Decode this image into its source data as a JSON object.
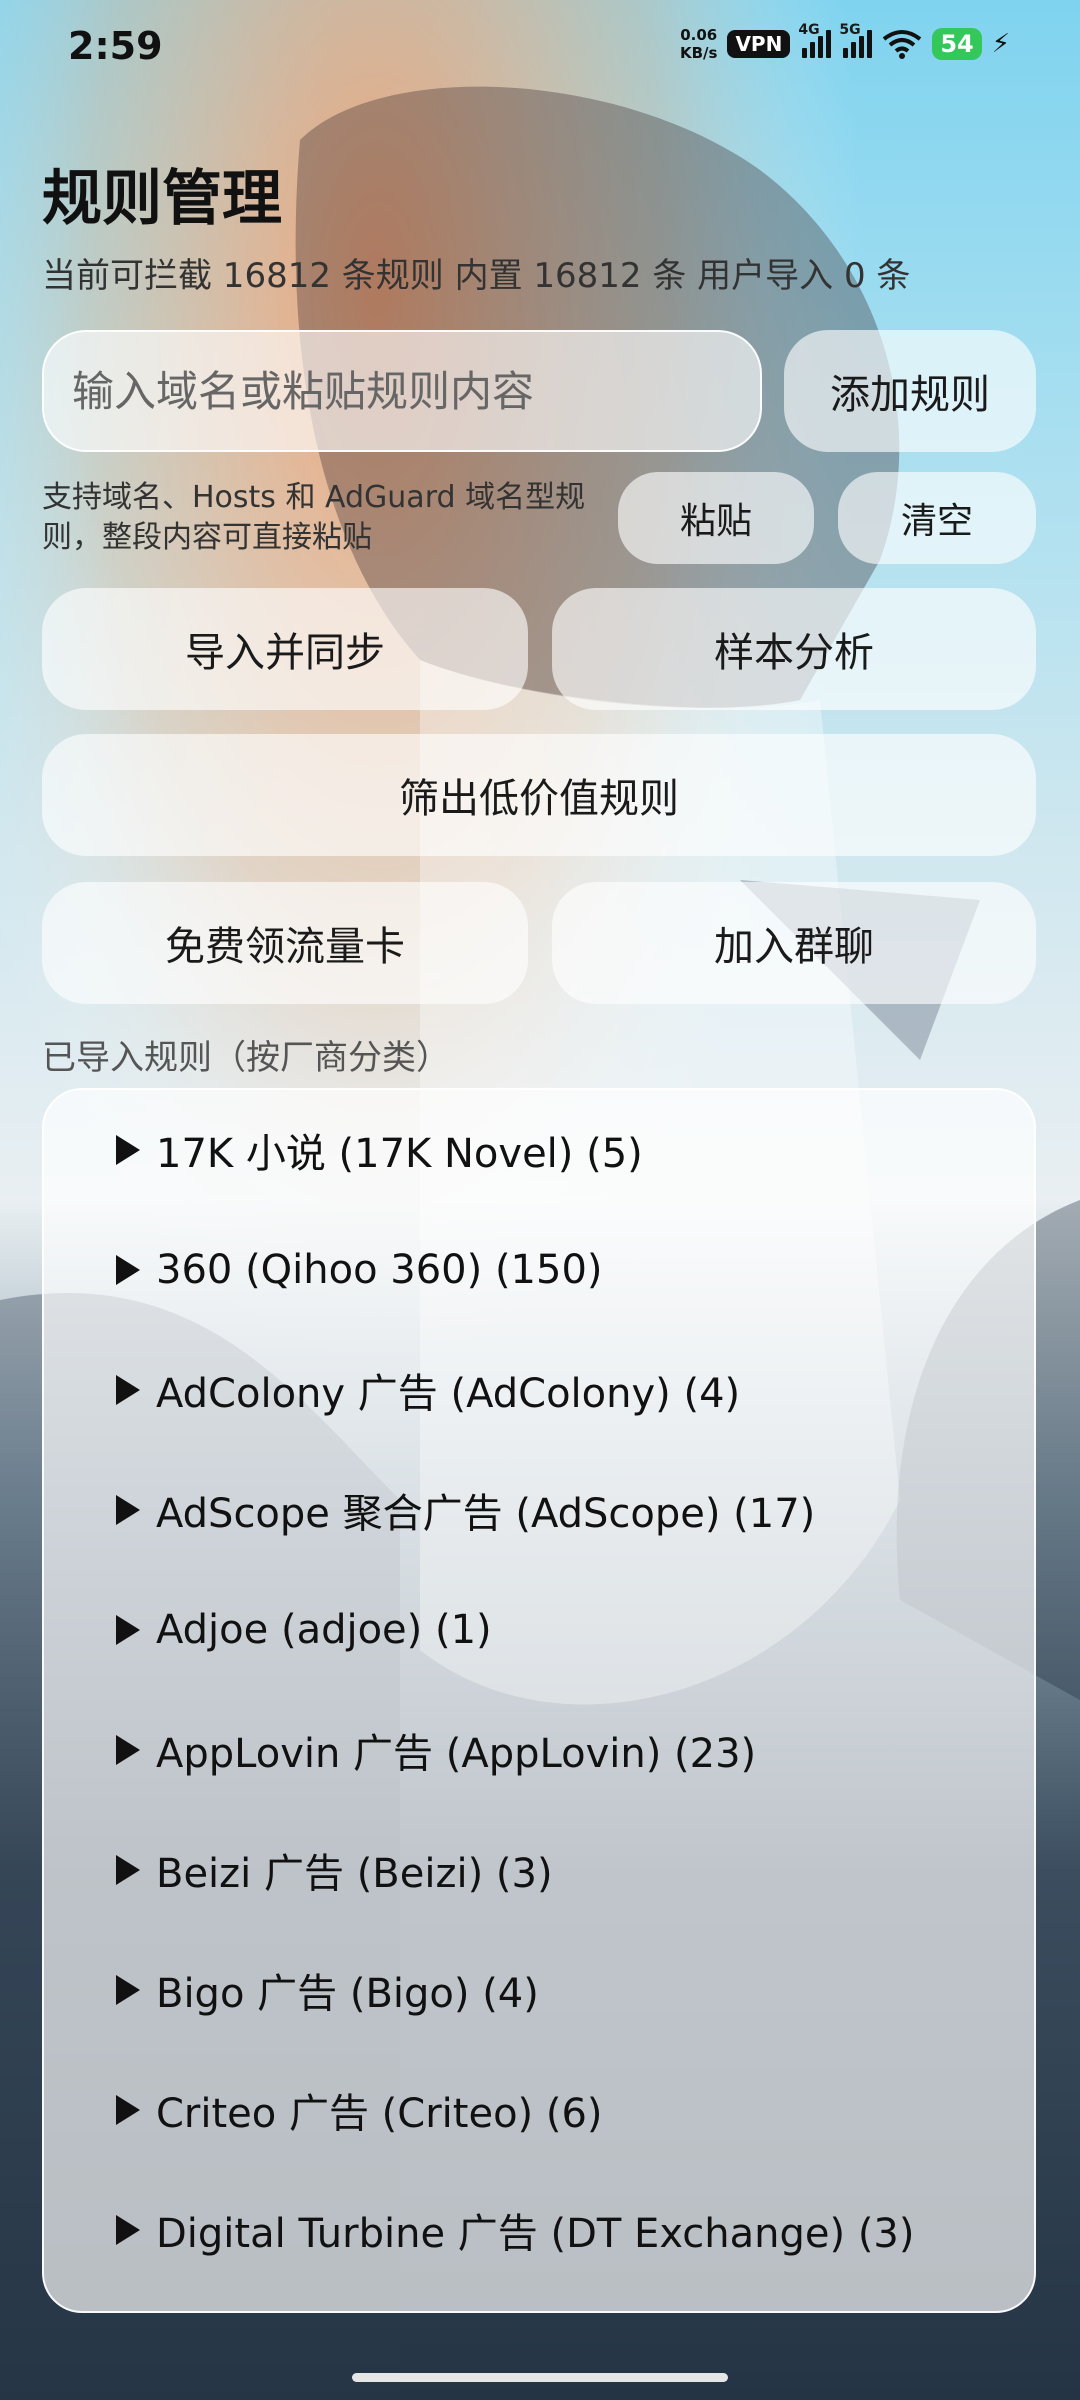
{
  "status_bar": {
    "time": "2:59",
    "net_speed_value": "0.06",
    "net_speed_unit": "KB/s",
    "vpn": "VPN",
    "signal_1_label": "4G",
    "signal_2_label": "5G",
    "battery": "54"
  },
  "header": {
    "title": "规则管理",
    "subtitle": "当前可拦截 16812 条规则  内置 16812 条  用户导入 0 条"
  },
  "rule_input": {
    "placeholder": "输入域名或粘贴规则内容",
    "value": ""
  },
  "buttons": {
    "add_rule": "添加规则",
    "paste": "粘贴",
    "clear": "清空",
    "import_sync": "导入并同步",
    "sample_analysis": "样本分析",
    "filter_low_value": "筛出低价值规则",
    "free_data_card": "免费领流量卡",
    "join_group": "加入群聊"
  },
  "hint": "支持域名、Hosts 和 AdGuard 域名型规则，整段内容可直接粘贴",
  "imported_section": {
    "label": "已导入规则（按厂商分类）",
    "items": [
      {
        "label": "17K 小说 (17K Novel) (5)"
      },
      {
        "label": "360 (Qihoo 360) (150)"
      },
      {
        "label": "AdColony 广告 (AdColony) (4)"
      },
      {
        "label": "AdScope 聚合广告 (AdScope) (17)"
      },
      {
        "label": "Adjoe (adjoe) (1)"
      },
      {
        "label": "AppLovin 广告 (AppLovin) (23)"
      },
      {
        "label": "Beizi 广告 (Beizi) (3)"
      },
      {
        "label": "Bigo 广告 (Bigo) (4)"
      },
      {
        "label": "Criteo 广告 (Criteo) (6)"
      },
      {
        "label": "Digital Turbine 广告 (DT Exchange) (3)"
      }
    ]
  }
}
